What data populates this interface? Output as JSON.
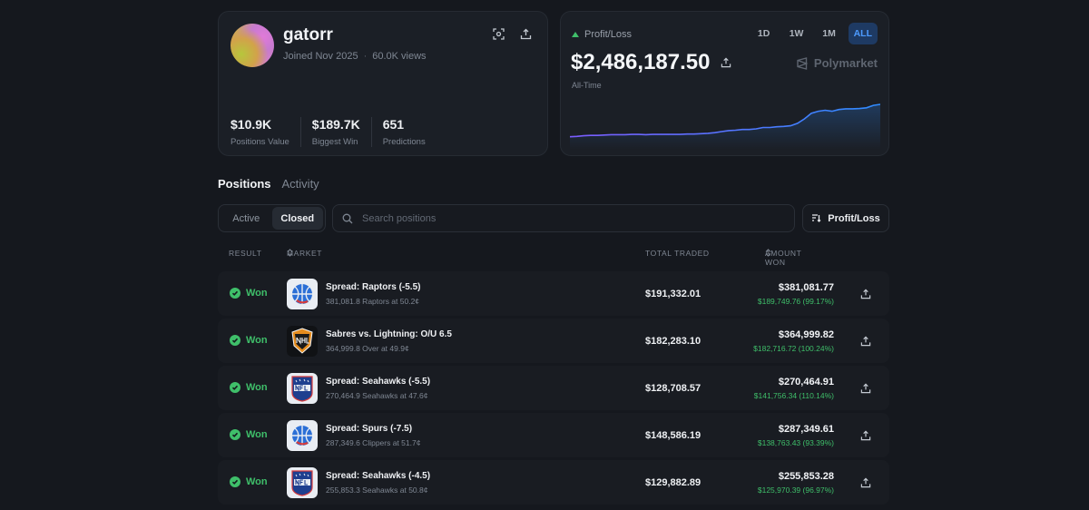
{
  "profile": {
    "username": "gatorr",
    "joined": "Joined Nov 2025",
    "views": "60.0K views",
    "stats": [
      {
        "value": "$10.9K",
        "label": "Positions Value"
      },
      {
        "value": "$189.7K",
        "label": "Biggest Win"
      },
      {
        "value": "651",
        "label": "Predictions"
      }
    ],
    "icons": [
      "scan-icon",
      "share-icon"
    ]
  },
  "pnl": {
    "label": "Profit/Loss",
    "value": "$2,486,187.50",
    "sub": "All-Time",
    "brand": "Polymarket",
    "ranges": [
      "1D",
      "1W",
      "1M",
      "ALL"
    ],
    "active_range": "ALL",
    "series": [
      0.06,
      0.07,
      0.09,
      0.1,
      0.1,
      0.11,
      0.12,
      0.12,
      0.12,
      0.13,
      0.13,
      0.12,
      0.13,
      0.13,
      0.13,
      0.13,
      0.13,
      0.14,
      0.14,
      0.15,
      0.16,
      0.18,
      0.21,
      0.24,
      0.25,
      0.27,
      0.27,
      0.29,
      0.33,
      0.33,
      0.35,
      0.36,
      0.38,
      0.45,
      0.58,
      0.74,
      0.8,
      0.83,
      0.8,
      0.85,
      0.87,
      0.87,
      0.88,
      0.9,
      0.97,
      1.0
    ],
    "colors": {
      "line_start": "#7c5cff",
      "line_end": "#2f8cff",
      "accent": "#3fbf6a"
    }
  },
  "tabs": [
    "Positions",
    "Activity"
  ],
  "active_tab": "Positions",
  "filters": {
    "segments": [
      "Active",
      "Closed"
    ],
    "active_segment": "Closed",
    "search_placeholder": "Search positions",
    "sort_label": "Profit/Loss"
  },
  "table": {
    "headers": {
      "result": "RESULT",
      "market": "MARKET",
      "total_traded": "TOTAL TRADED",
      "amount_won": "AMOUNT WON"
    },
    "rows": [
      {
        "result": "Won",
        "logo": "nba-icon",
        "title": "Spread: Raptors (-5.5)",
        "sub": "381,081.8 Raptors at 50.2¢",
        "traded": "$191,332.01",
        "won": "$381,081.77",
        "gain": "$189,749.76 (99.17%)"
      },
      {
        "result": "Won",
        "logo": "nhl-icon",
        "title": "Sabres vs. Lightning: O/U 6.5",
        "sub": "364,999.8 Over at 49.9¢",
        "traded": "$182,283.10",
        "won": "$364,999.82",
        "gain": "$182,716.72 (100.24%)"
      },
      {
        "result": "Won",
        "logo": "nfl-icon",
        "title": "Spread: Seahawks (-5.5)",
        "sub": "270,464.9 Seahawks at 47.6¢",
        "traded": "$128,708.57",
        "won": "$270,464.91",
        "gain": "$141,756.34 (110.14%)"
      },
      {
        "result": "Won",
        "logo": "nba-icon",
        "title": "Spread: Spurs (-7.5)",
        "sub": "287,349.6 Clippers at 51.7¢",
        "traded": "$148,586.19",
        "won": "$287,349.61",
        "gain": "$138,763.43 (93.39%)"
      },
      {
        "result": "Won",
        "logo": "nfl-icon",
        "title": "Spread: Seahawks (-4.5)",
        "sub": "255,853.3 Seahawks at 50.8¢",
        "traded": "$129,882.89",
        "won": "$255,853.28",
        "gain": "$125,970.39 (96.97%)"
      }
    ]
  }
}
